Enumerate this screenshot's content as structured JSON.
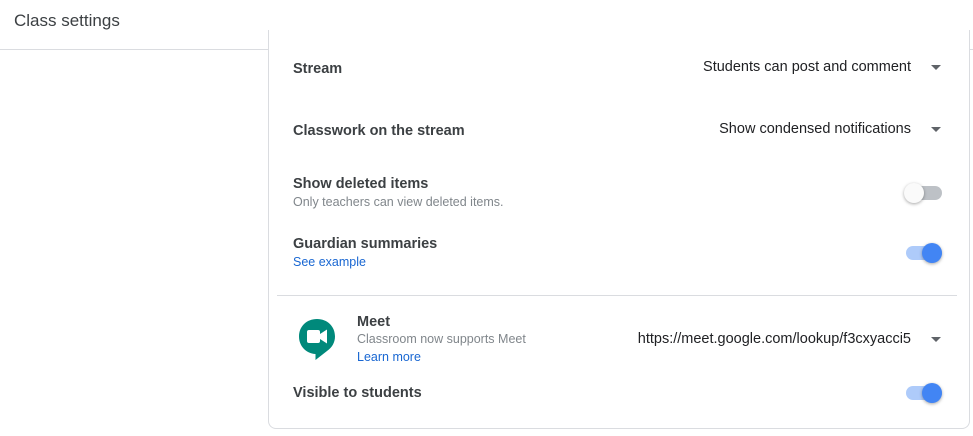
{
  "header": {
    "title": "Class settings"
  },
  "general": {
    "stream": {
      "label": "Stream",
      "value": "Students can post and comment"
    },
    "classwork_stream": {
      "label": "Classwork on the stream",
      "value": "Show condensed notifications"
    },
    "deleted_items": {
      "label": "Show deleted items",
      "description": "Only teachers can view deleted items.",
      "enabled": false
    },
    "guardian_summaries": {
      "label": "Guardian summaries",
      "link": "See example",
      "enabled": true
    }
  },
  "meet": {
    "name": "Meet",
    "description": "Classroom now supports Meet",
    "learn_more": "Learn more",
    "link_value": "https://meet.google.com/lookup/f3cxyacci5",
    "visible": {
      "label": "Visible to students",
      "enabled": true
    },
    "icon": "meet-icon",
    "icon_color": "#00897b"
  },
  "colors": {
    "accent": "#4285f4",
    "link": "#1967d2"
  }
}
